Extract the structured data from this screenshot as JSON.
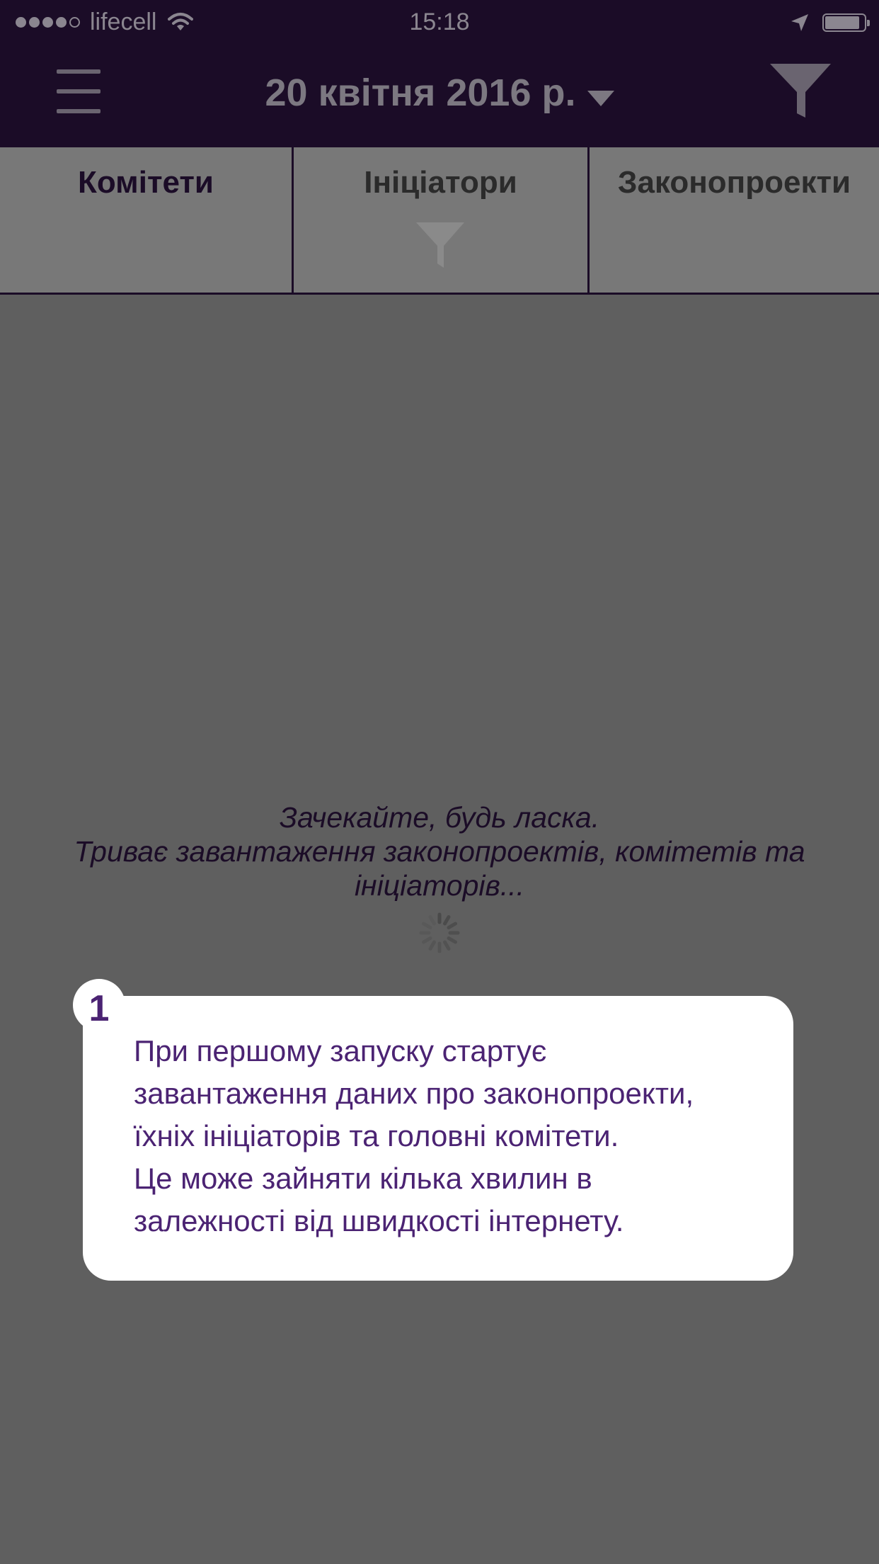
{
  "status_bar": {
    "carrier": "lifecell",
    "time": "15:18",
    "signal_bars": 4,
    "signal_max": 5,
    "battery_level": 0.8,
    "icons": [
      "wifi-icon",
      "location-arrow-icon",
      "battery-icon"
    ]
  },
  "nav": {
    "menu_icon": "hamburger-icon",
    "date": "20 квітня 2016 р.",
    "date_dropdown_icon": "caret-down-icon",
    "filter_icon": "filter-icon"
  },
  "tabs": [
    {
      "label": "Комітети",
      "active": true
    },
    {
      "label": "Ініціатори",
      "active": false,
      "icon": "filter-icon"
    },
    {
      "label": "Законопроекти",
      "active": false
    }
  ],
  "loading": {
    "line1": "Зачекайте, будь ласка.",
    "line2": "Триває завантаження законопроектів, комітетів та ініціаторів...",
    "spinner_icon": "loading-spinner-icon"
  },
  "hint": {
    "number": "1",
    "lines": [
      "При першому запуску стартує",
      "завантаження даних про законопроекти,",
      "їхніх ініціаторів та головні комітети.",
      "Це може зайняти кілька хвилин в",
      "залежності від швидкості інтернету."
    ]
  },
  "colors": {
    "nav_background": "#1b0c27",
    "overlay": "#5f5f5f",
    "tab_background": "#787878",
    "hint_text": "#4b2373",
    "hint_background": "#ffffff"
  }
}
